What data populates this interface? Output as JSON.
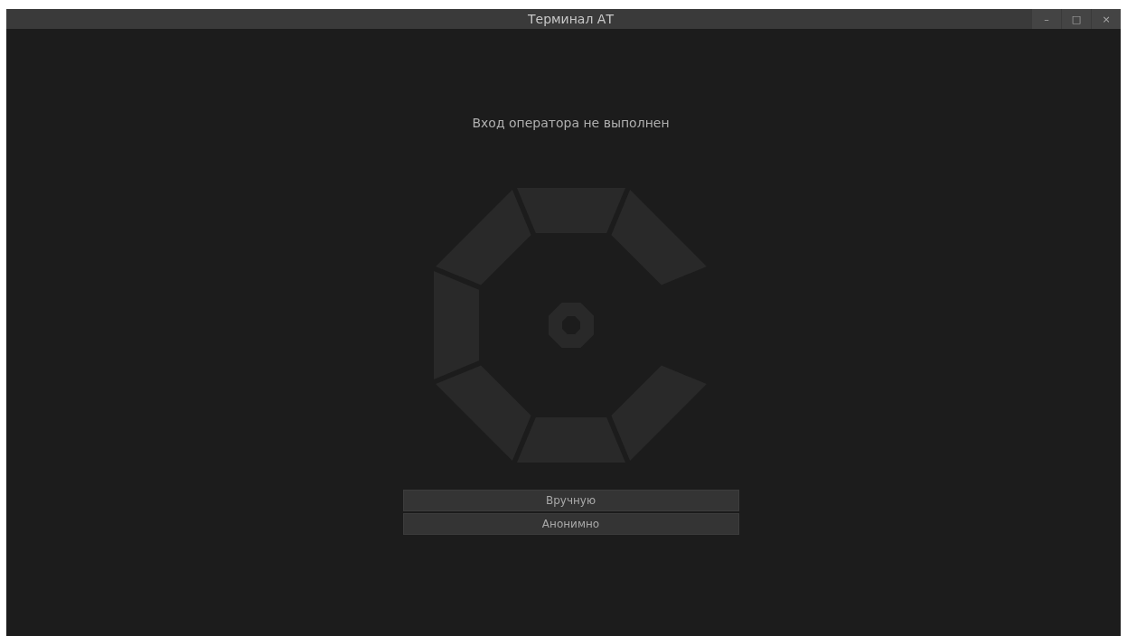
{
  "window": {
    "title": "Терминал АТ",
    "controls": [
      "–",
      "□",
      "×"
    ]
  },
  "status": {
    "message": "Вход оператора не выполнен"
  },
  "buttons": [
    {
      "label": "Вручную"
    },
    {
      "label": "Анонимно"
    }
  ]
}
